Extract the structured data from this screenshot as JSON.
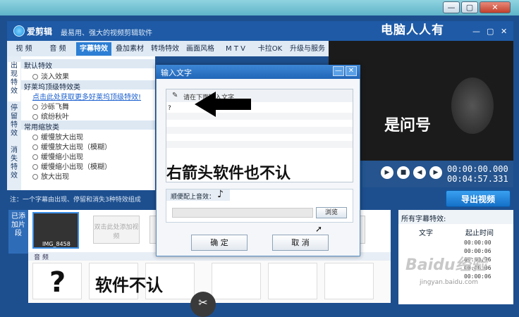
{
  "window": {
    "minimize": "—",
    "maximize": "▢",
    "close": "✕"
  },
  "app": {
    "name": "爱剪辑",
    "slogan": "最易用、强大的视频剪辑软件",
    "watermark": "电脑人人有",
    "win_min": "—",
    "win_max": "▢",
    "win_close": "✕"
  },
  "tabs": [
    "视 频",
    "音 频",
    "字幕特效",
    "叠加素材",
    "转场特效",
    "画面风格",
    "M T V",
    "卡拉OK",
    "升级与服务"
  ],
  "sidetabs": [
    "出现特效",
    "停留特效",
    "消失特效"
  ],
  "leftlist": {
    "group1": "默认特效",
    "item_fade": "淡入效果",
    "group2": "好莱坞顶级特效类",
    "promo": "点击此处获取更多好莱坞顶级特效!",
    "item_sand": "沙砾飞舞",
    "item_colorful": "缤纷秋叶",
    "group3": "常用缩放类",
    "items": [
      "缓慢放大出现",
      "缓慢放大出现（模糊）",
      "缓慢缩小出现",
      "缓慢缩小出现（模糊）",
      "放大出现"
    ]
  },
  "preview": {
    "overlay_text": "是问号",
    "time_current": "00:00:00.000",
    "time_total": "00:04:57.331"
  },
  "export_label": "导出视频",
  "note": "注：一个字幕由出现、停留和消失3种特效组成",
  "bottom": {
    "added_tab": "已添加片段",
    "clip_name": "IMG_8458",
    "placeholder1": "双击此处添加视频",
    "audio_label": "音 频",
    "overlay_text": "软件不认",
    "qmark": "?"
  },
  "subpanel": {
    "title": "所有字幕特效:",
    "col_text": "文字",
    "col_start": "起止时间",
    "times": [
      "00:00:00",
      "00:00:06",
      "00:00:06",
      "00:00:06",
      "00:00:06"
    ],
    "baidu": "Baidu经验",
    "baidu_url": "jingyan.baidu.com"
  },
  "dialog": {
    "title": "输入文字",
    "hint": "请在下面输入文字",
    "typed": "?",
    "handwritten": "右箭头软件也不认",
    "music_label": "顺便配上音效：",
    "browse": "浏览",
    "ok": "确 定",
    "cancel": "取 消",
    "min": "—",
    "close": "✕"
  },
  "colors": {
    "accent": "#2c7fd4",
    "header": "#1e5aa6",
    "dialog_title": "#2166b8"
  }
}
